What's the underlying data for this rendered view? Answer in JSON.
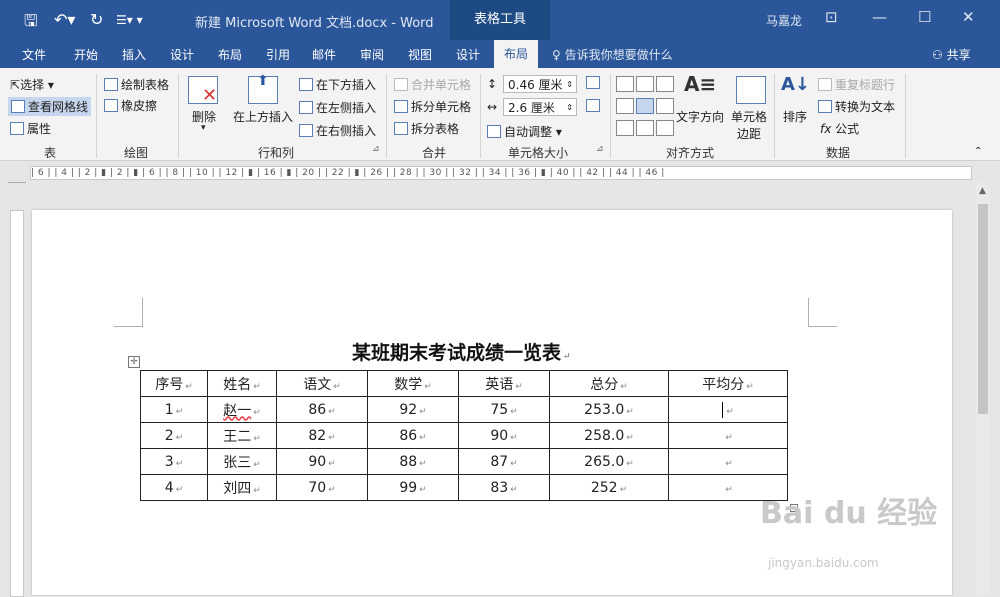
{
  "title_bar": {
    "document_title": "新建 Microsoft Word 文档.docx  -  Word",
    "context_tools": "表格工具",
    "user": "马嘉龙",
    "qa_icons": [
      "save-icon",
      "undo-icon",
      "redo-icon",
      "customize-icon"
    ]
  },
  "tabs": [
    "文件",
    "开始",
    "插入",
    "设计",
    "布局",
    "引用",
    "邮件",
    "审阅",
    "视图",
    "设计",
    "布局"
  ],
  "active_tab": "布局",
  "tell_me": "告诉我你想要做什么",
  "share": "共享",
  "ribbon": {
    "table_group": {
      "label": "表",
      "select": "选择",
      "gridlines": "查看网格线",
      "properties": "属性"
    },
    "draw_group": {
      "label": "绘图",
      "draw_table": "绘制表格",
      "eraser": "橡皮擦"
    },
    "rows_cols": {
      "label": "行和列",
      "delete": "删除",
      "insert_above": "在上方插入",
      "insert_below": "在下方插入",
      "insert_left": "在左侧插入",
      "insert_right": "在右侧插入"
    },
    "merge": {
      "label": "合并",
      "merge_cells": "合并单元格",
      "split_cells": "拆分单元格",
      "split_table": "拆分表格"
    },
    "cell_size": {
      "label": "单元格大小",
      "height": "0.46 厘米",
      "width": "2.6 厘米",
      "autofit": "自动调整"
    },
    "alignment": {
      "label": "对齐方式",
      "text_direction": "文字方向",
      "cell_margins": "单元格边距"
    },
    "data": {
      "label": "数据",
      "sort": "排序",
      "repeat_header": "重复标题行",
      "convert": "转换为文本",
      "formula": "公式"
    }
  },
  "ruler": {
    "tab_selector": "L",
    "h_marks": "| 6 |   | 4 |   | 2 |   ▮   | 2 |   ▮   | 6 |   | 8 |   | 10 |   | 12 |   ▮   | 16 |   ▮   | 20 |   | 22 |   ▮   | 26 |   | 28 |   | 30 |   | 32 |   | 34 |   | 36 |   ▮   | 40 |   | 42 |   | 44 |   | 46 |"
  },
  "document": {
    "heading": "某班期末考试成绩一览表",
    "table": {
      "headers": [
        "序号",
        "姓名",
        "语文",
        "数学",
        "英语",
        "总分",
        "平均分"
      ],
      "rows": [
        [
          "1",
          "赵一",
          "86",
          "92",
          "75",
          "253.0",
          ""
        ],
        [
          "2",
          "王二",
          "82",
          "86",
          "90",
          "258.0",
          ""
        ],
        [
          "3",
          "张三",
          "90",
          "88",
          "87",
          "265.0",
          ""
        ],
        [
          "4",
          "刘四",
          "70",
          "99",
          "83",
          "252",
          ""
        ]
      ]
    }
  },
  "watermark": {
    "brand": "Bai du 经验",
    "url": "jingyan.baidu.com"
  }
}
